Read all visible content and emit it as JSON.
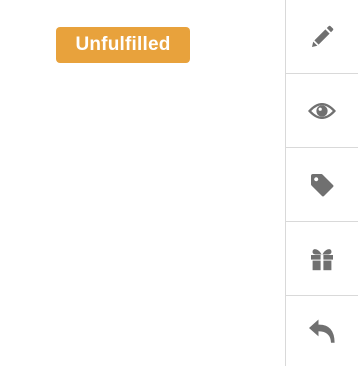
{
  "status": {
    "label": "Unfulfilled",
    "color": "#e8a23c",
    "text_color": "#ffffff"
  },
  "toolbar": {
    "icon_color": "#707070",
    "divider_color": "#d9d9d9",
    "tools": [
      {
        "icon": "pencil-icon"
      },
      {
        "icon": "eye-icon"
      },
      {
        "icon": "tag-icon"
      },
      {
        "icon": "gift-icon"
      },
      {
        "icon": "undo-arrow-icon"
      }
    ]
  }
}
